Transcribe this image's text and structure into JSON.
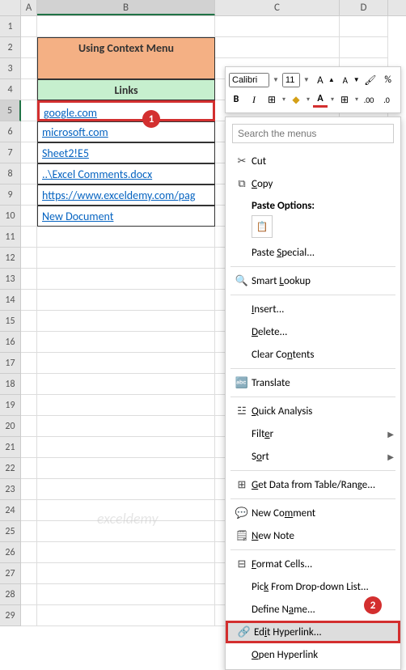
{
  "columns": [
    "A",
    "B",
    "C",
    "D"
  ],
  "rows": [
    "1",
    "2",
    "3",
    "4",
    "5",
    "6",
    "7",
    "8",
    "9",
    "10",
    "11",
    "12",
    "13",
    "14",
    "15",
    "16",
    "17",
    "18",
    "19",
    "20",
    "21",
    "22",
    "23",
    "24",
    "25",
    "26",
    "27",
    "28",
    "29"
  ],
  "title": "Using Context Menu",
  "links_header": "Links",
  "links": [
    "google.com",
    "microsoft.com",
    "Sheet2!E5",
    "..\\Excel Comments.docx",
    "https://www.exceldemy.com/pag",
    "New Document"
  ],
  "callouts": {
    "one": "1",
    "two": "2"
  },
  "mini": {
    "font": "Calibri",
    "size": "11",
    "inc": "A",
    "dec": "A",
    "bold": "B",
    "italic": "I"
  },
  "ctx": {
    "search_ph": "Search the menus",
    "cut": "Cut",
    "copy": "Copy",
    "paste_options": "Paste Options:",
    "paste_special": "Paste Special...",
    "smart_lookup": "Smart Lookup",
    "insert": "Insert...",
    "delete": "Delete...",
    "clear": "Clear Contents",
    "translate": "Translate",
    "quick": "Quick Analysis",
    "filter": "Filter",
    "sort": "Sort",
    "get_data": "Get Data from Table/Range...",
    "new_comment": "New Comment",
    "new_note": "New Note",
    "format": "Format Cells...",
    "pick": "Pick From Drop-down List...",
    "define": "Define Name...",
    "edit_link": "Edit Hyperlink...",
    "open_link": "Open Hyperlink"
  },
  "watermark": "exceldemy"
}
